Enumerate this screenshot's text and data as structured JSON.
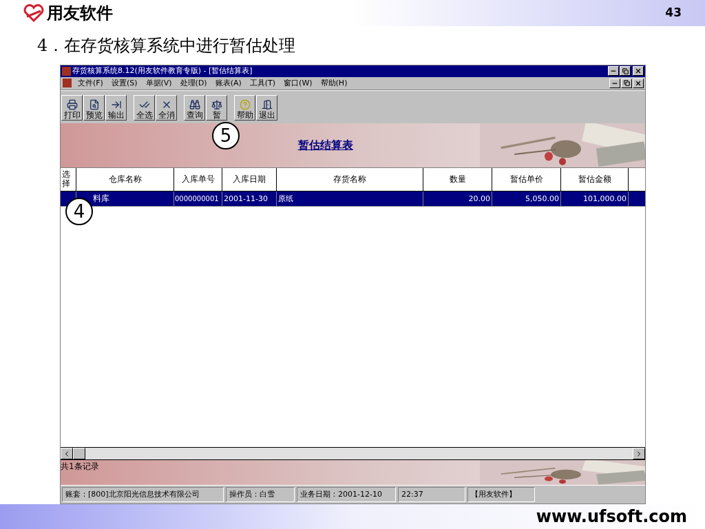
{
  "slide": {
    "brand": "用友软件",
    "page_number": "43",
    "heading": "4．在存货核算系统中进行暂估处理",
    "footer_url": "www.ufsoft.com"
  },
  "window": {
    "title": "存货核算系统8.12(用友软件教育专版) - [暂估结算表]"
  },
  "menu": [
    "文件(F)",
    "设置(S)",
    "单据(V)",
    "处理(D)",
    "账表(A)",
    "工具(T)",
    "窗口(W)",
    "帮助(H)"
  ],
  "toolbar": [
    [
      "打印",
      "预览",
      "输出"
    ],
    [
      "全选",
      "全消"
    ],
    [
      "查询",
      "暂"
    ],
    [
      "帮助",
      "退出"
    ]
  ],
  "report_title": "暂估结算表",
  "table": {
    "columns": [
      "选择",
      "仓库名称",
      "入库单号",
      "入库日期",
      "存货名称",
      "数量",
      "暂估单价",
      "暂估金额"
    ],
    "rows": [
      {
        "selected": true,
        "cells": [
          "",
          "料库",
          "0000000001",
          "2001-11-30",
          "原纸",
          "20.00",
          "5,050.00",
          "101,000.00"
        ]
      }
    ]
  },
  "record_count": "共1条记录",
  "status_bar": [
    "账套：[800]北京阳光信息技术有限公司",
    "操作员：白雪",
    "业务日期：2001-12-10",
    "22:37",
    "【用友软件】"
  ],
  "callouts": [
    {
      "label": "5"
    },
    {
      "label": "4"
    }
  ]
}
